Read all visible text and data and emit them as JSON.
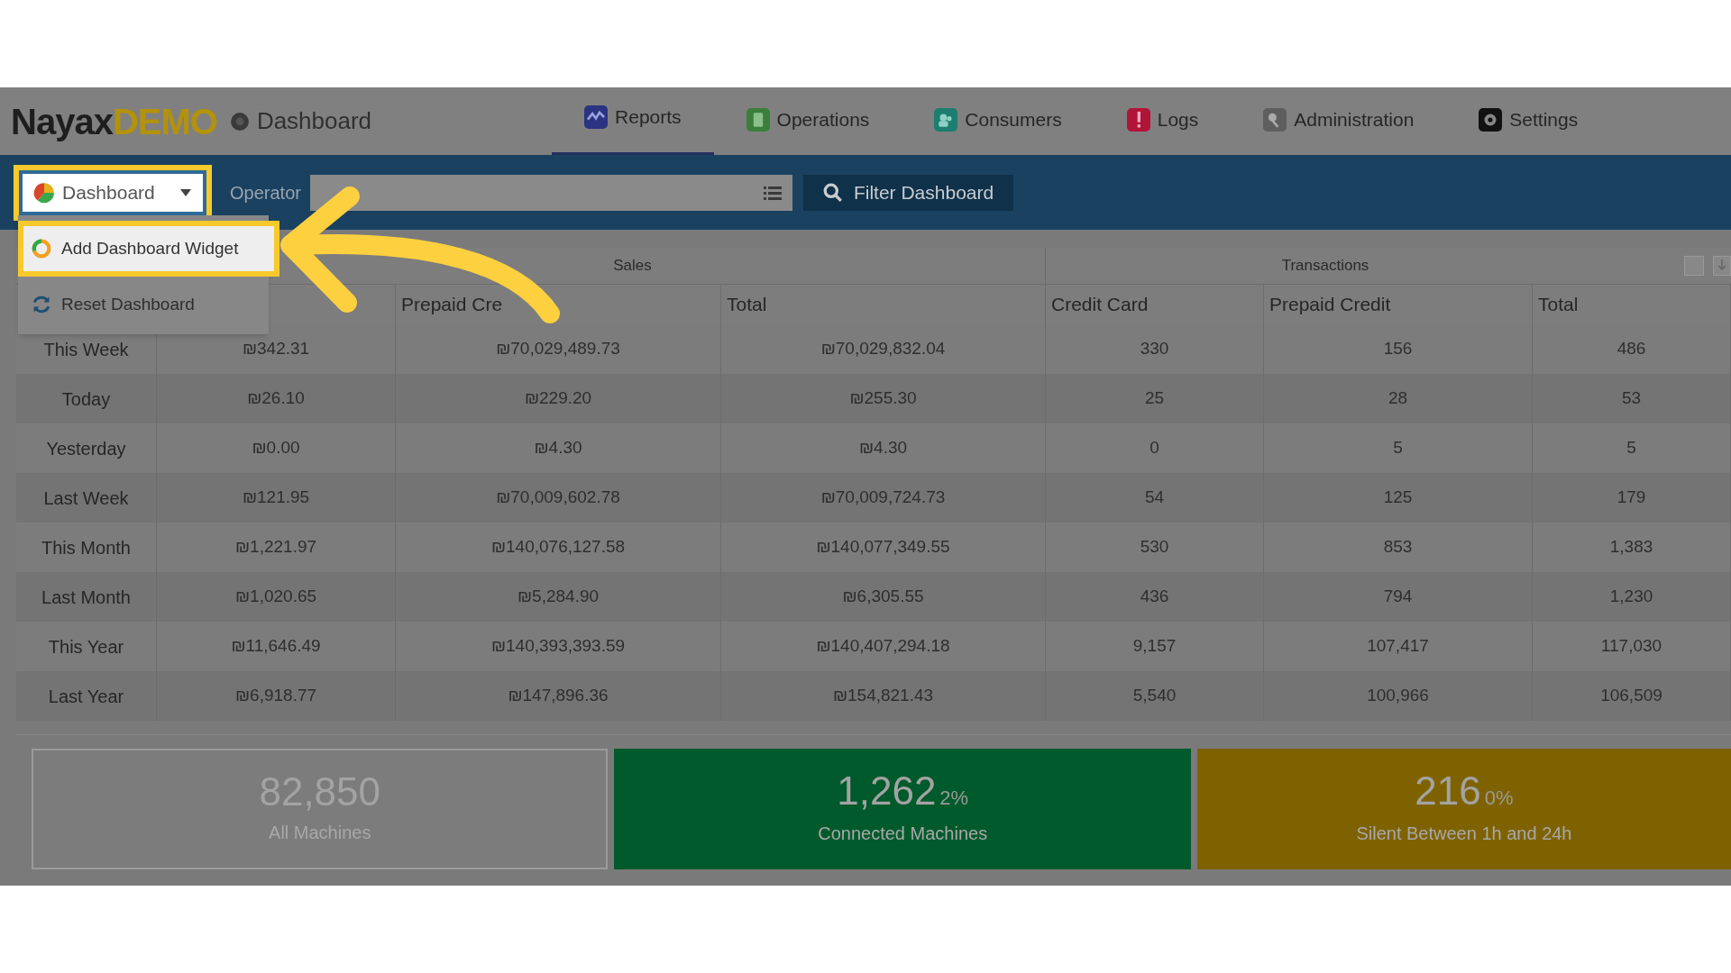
{
  "header": {
    "logo": {
      "name": "Nayax",
      "suffix": "DEMO"
    },
    "page_title": "Dashboard",
    "nav": [
      {
        "label": "Reports",
        "kind": "reports",
        "selected": true
      },
      {
        "label": "Operations",
        "kind": "operations",
        "selected": false
      },
      {
        "label": "Consumers",
        "kind": "consumers",
        "selected": false
      },
      {
        "label": "Logs",
        "kind": "logs",
        "selected": false
      },
      {
        "label": "Administration",
        "kind": "administration",
        "selected": false
      },
      {
        "label": "Settings",
        "kind": "settings",
        "selected": false
      }
    ]
  },
  "toolbar": {
    "dashboard_menu": {
      "label": "Dashboard",
      "items": [
        {
          "label": "Add Dashboard Widget",
          "kind": "add",
          "highlighted": true
        },
        {
          "label": "Reset Dashboard",
          "kind": "reset",
          "highlighted": false
        }
      ]
    },
    "operator_label": "Operator",
    "filter_button": "Filter Dashboard"
  },
  "table": {
    "groups": [
      "Sales",
      "Transactions"
    ],
    "select_all": {
      "checked": false
    },
    "columns": [
      "Prepaid Cre",
      "Total",
      "Credit Card",
      "Prepaid Credit",
      "Total"
    ],
    "rows": [
      [
        "This Week",
        "₪342.31",
        "₪70,029,489.73",
        "₪70,029,832.04",
        "330",
        "156",
        "486"
      ],
      [
        "Today",
        "₪26.10",
        "₪229.20",
        "₪255.30",
        "25",
        "28",
        "53"
      ],
      [
        "Yesterday",
        "₪0.00",
        "₪4.30",
        "₪4.30",
        "0",
        "5",
        "5"
      ],
      [
        "Last Week",
        "₪121.95",
        "₪70,009,602.78",
        "₪70,009,724.73",
        "54",
        "125",
        "179"
      ],
      [
        "This Month",
        "₪1,221.97",
        "₪140,076,127.58",
        "₪140,077,349.55",
        "530",
        "853",
        "1,383"
      ],
      [
        "Last Month",
        "₪1,020.65",
        "₪5,284.90",
        "₪6,305.55",
        "436",
        "794",
        "1,230"
      ],
      [
        "This Year",
        "₪11,646.49",
        "₪140,393,393.59",
        "₪140,407,294.18",
        "9,157",
        "107,417",
        "117,030"
      ],
      [
        "Last Year",
        "₪6,918.77",
        "₪147,896.36",
        "₪154,821.43",
        "5,540",
        "100,966",
        "106,509"
      ]
    ]
  },
  "cards": [
    {
      "kind": "all",
      "value": "82,850",
      "label": "All Machines"
    },
    {
      "kind": "connected",
      "value": "1,262",
      "percent": "2%",
      "label": "Connected Machines"
    },
    {
      "kind": "silent",
      "value": "216",
      "percent": "0%",
      "label": "Silent Between 1h and 24h"
    }
  ]
}
